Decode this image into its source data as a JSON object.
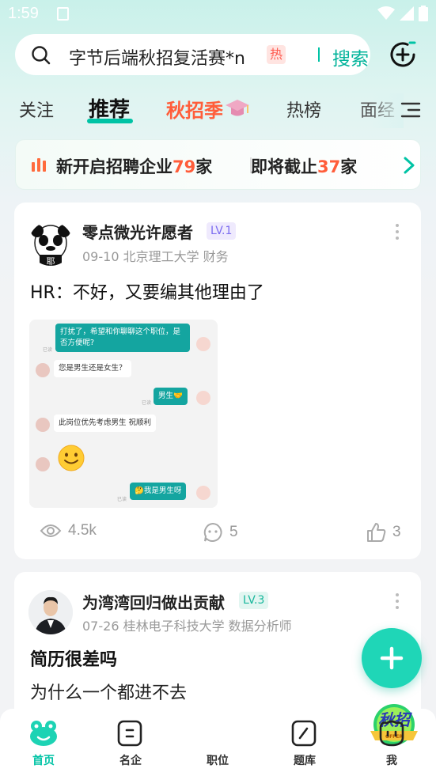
{
  "status_bar": {
    "time": "1:59"
  },
  "search": {
    "query": "字节后端秋招复活赛*n",
    "hot_badge": "热",
    "button": "搜索"
  },
  "tabs": [
    {
      "label": "关注"
    },
    {
      "label": "推荐"
    },
    {
      "label": "秋招季"
    },
    {
      "label": "热榜"
    },
    {
      "label": "面经"
    }
  ],
  "banner": {
    "text1": "新开启招聘企业",
    "num1": "79",
    "unit1": "家",
    "text2": "即将截止",
    "num2": "37",
    "unit2": "家"
  },
  "posts": [
    {
      "author": "零点微光许愿者",
      "level": "LV.1",
      "meta": "09-10 北京理工大学 财务",
      "title": "HR：不好，又要编其他理由了",
      "chat": {
        "m1": "打扰了，希望和你聊聊这个职位，是否方便呢?",
        "m2": "您是男生还是女生？",
        "m3": "男生🤝",
        "m4": "此岗位优先考虑男生 祝顺利",
        "m6": "🤔我是男生呀",
        "read": "已读"
      },
      "views": "4.5k",
      "comments": "5",
      "likes": "3"
    },
    {
      "author": "为湾湾回归做出贡献",
      "level": "LV.3",
      "meta": "07-26 桂林电子科技大学 数据分析师",
      "title": "简历很差吗",
      "body": "为什么一个都进不去"
    }
  ],
  "bottom_nav": [
    {
      "label": "首页"
    },
    {
      "label": "名企"
    },
    {
      "label": "职位"
    },
    {
      "label": "题库"
    },
    {
      "label": "我"
    }
  ],
  "autumn_badge": {
    "text": "秋招",
    "ribbon": "OFFER"
  },
  "colors": {
    "accent": "#00c3a5",
    "autumn": "#ff5d3a",
    "lv1": "#7b6cf0",
    "lv3": "#19b79c"
  }
}
